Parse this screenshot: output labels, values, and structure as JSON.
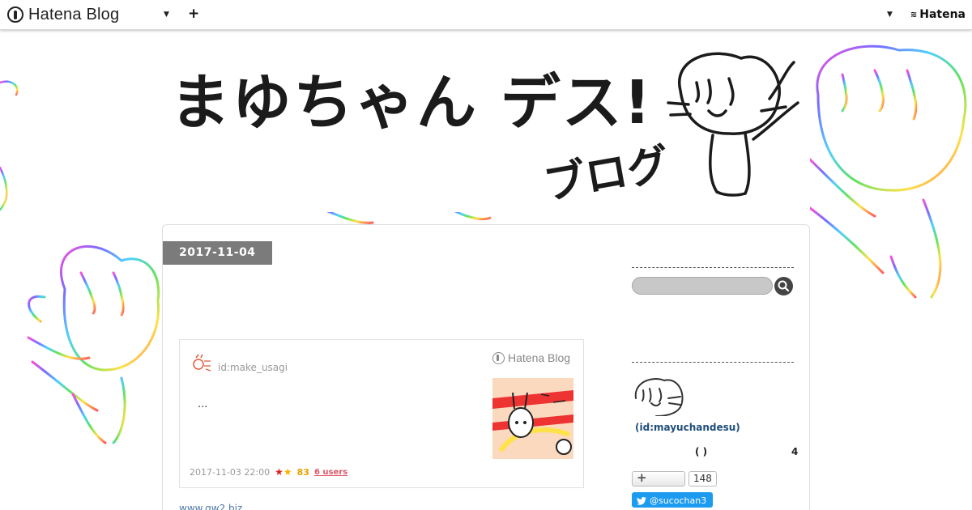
{
  "topbar": {
    "brand": "Hatena Blog",
    "plus_icon": "plus-icon",
    "account_label": "Hatena"
  },
  "header": {
    "title": "まゆちゃん デス!",
    "subtitle": "ブログ"
  },
  "entry": {
    "date": "2017-11-04",
    "embed": {
      "user": "id:make_usagi",
      "brand": "Hatena Blog",
      "excerpt": "...",
      "date": "2017-11-03 22:00",
      "star_count": "83",
      "users": "6 users"
    },
    "bottom_link": "www.gw2.biz"
  },
  "sidebar": {
    "search_placeholder": "",
    "profile_id": "(id:mayuchandesu)",
    "paren": "( )",
    "count": "4",
    "follow_count": "148",
    "twitter_label": "@sucochan3"
  },
  "colors": {
    "date_tab": "#7b7b7b",
    "twitter": "#1d9bf0",
    "link": "#4a77a8",
    "profile": "#1f4e7a"
  }
}
